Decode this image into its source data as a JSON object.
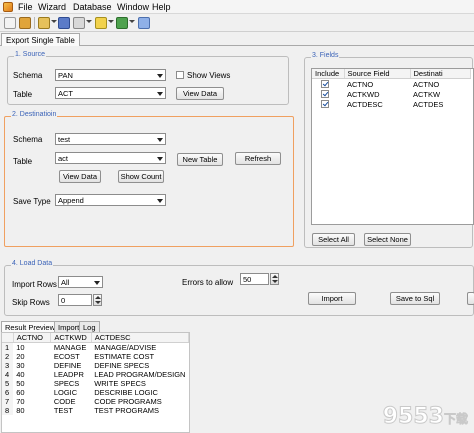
{
  "menu": {
    "items": [
      "File",
      "Wizard",
      "Database",
      "Window",
      "Help"
    ]
  },
  "toolbar": {
    "icons": [
      "new-icon",
      "open-icon",
      "connect-icon",
      "wand-icon",
      "export-icon",
      "grid-icon"
    ]
  },
  "tabs": {
    "main": "Export Single Table"
  },
  "source": {
    "title": "1. Source",
    "schema_label": "Schema",
    "schema_value": "PAN",
    "table_label": "Table",
    "table_value": "ACT",
    "show_views_label": "Show Views",
    "view_data_label": "View Data"
  },
  "destination": {
    "title": "2. Destinatioin",
    "schema_label": "Schema",
    "schema_value": "test",
    "table_label": "Table",
    "table_value": "act",
    "new_table_label": "New Table",
    "refresh_label": "Refresh",
    "view_data_label": "View Data",
    "show_count_label": "Show Count",
    "save_type_label": "Save Type",
    "save_type_value": "Append"
  },
  "fields": {
    "title": "3. Fields",
    "columns": [
      "Include",
      "Source Field",
      "Destinati"
    ],
    "rows": [
      {
        "include": true,
        "source": "ACTNO",
        "dest": "ACTNO"
      },
      {
        "include": true,
        "source": "ACTKWD",
        "dest": "ACTKW"
      },
      {
        "include": true,
        "source": "ACTDESC",
        "dest": "ACTDES"
      }
    ],
    "select_all_label": "Select All",
    "select_none_label": "Select None"
  },
  "load": {
    "title": "4. Load Data",
    "import_rows_label": "Import Rows",
    "import_rows_value": "All",
    "skip_rows_label": "Skip Rows",
    "skip_rows_value": "0",
    "errors_label": "Errors to allow",
    "errors_value": "50",
    "import_label": "Import",
    "save_sql_label": "Save to Sql"
  },
  "bottom_tabs": [
    "Result Preview",
    "Import",
    "Log"
  ],
  "preview": {
    "columns": [
      "",
      "ACTNO",
      "ACTKWD",
      "ACTDESC"
    ],
    "rows": [
      [
        "1",
        "10",
        "MANAGE",
        "MANAGE/ADVISE"
      ],
      [
        "2",
        "20",
        "ECOST",
        "ESTIMATE COST"
      ],
      [
        "3",
        "30",
        "DEFINE",
        "DEFINE SPECS"
      ],
      [
        "4",
        "40",
        "LEADPR",
        "LEAD PROGRAM/DESIGN"
      ],
      [
        "5",
        "50",
        "SPECS",
        "WRITE SPECS"
      ],
      [
        "6",
        "60",
        "LOGIC",
        "DESCRIBE LOGIC"
      ],
      [
        "7",
        "70",
        "CODE",
        "CODE PROGRAMS"
      ],
      [
        "8",
        "80",
        "TEST",
        "TEST PROGRAMS"
      ]
    ]
  },
  "watermark": {
    "text": "9553",
    "suffix": "下载"
  },
  "colors": {
    "accent": "#3b63b8",
    "highlight_border": "#f0a060"
  }
}
